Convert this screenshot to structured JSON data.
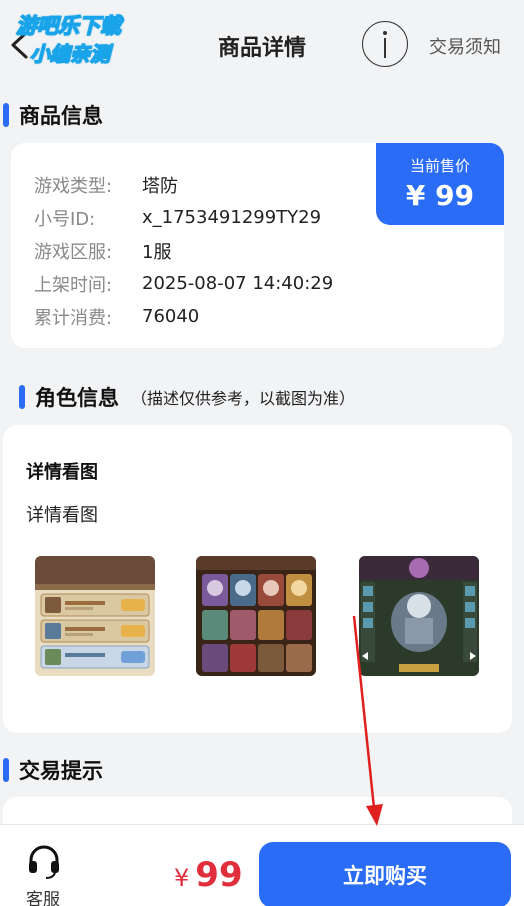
{
  "header": {
    "title": "商品详情",
    "notice_label": "交易须知",
    "watermark_line1": "游吧乐下载",
    "watermark_line2": "小编亲测"
  },
  "product_section": {
    "title": "商品信息",
    "price_label": "当前售价",
    "price": "¥ 99",
    "rows": [
      {
        "label": "游戏类型:",
        "value": "塔防"
      },
      {
        "label": "小号ID:",
        "value": "x_1753491299TY29"
      },
      {
        "label": "游戏区服:",
        "value": "1服"
      },
      {
        "label": "上架时间:",
        "value": "2025-08-07 14:40:29"
      },
      {
        "label": "累计消费:",
        "value": "76040"
      }
    ]
  },
  "role_section": {
    "title": "角色信息",
    "subtitle": "（描述仅供参考，以截图为准）",
    "detail_title": "详情看图",
    "detail_text": "详情看图"
  },
  "tip_section": {
    "title": "交易提示"
  },
  "bottom_bar": {
    "service_label": "客服",
    "currency": "¥",
    "price": "99",
    "buy_label": "立即购买"
  },
  "colors": {
    "accent": "#2a6cf6",
    "price_red": "#e02e3c",
    "background": "#f2f3f5",
    "annotation_arrow": "#e0201e"
  }
}
